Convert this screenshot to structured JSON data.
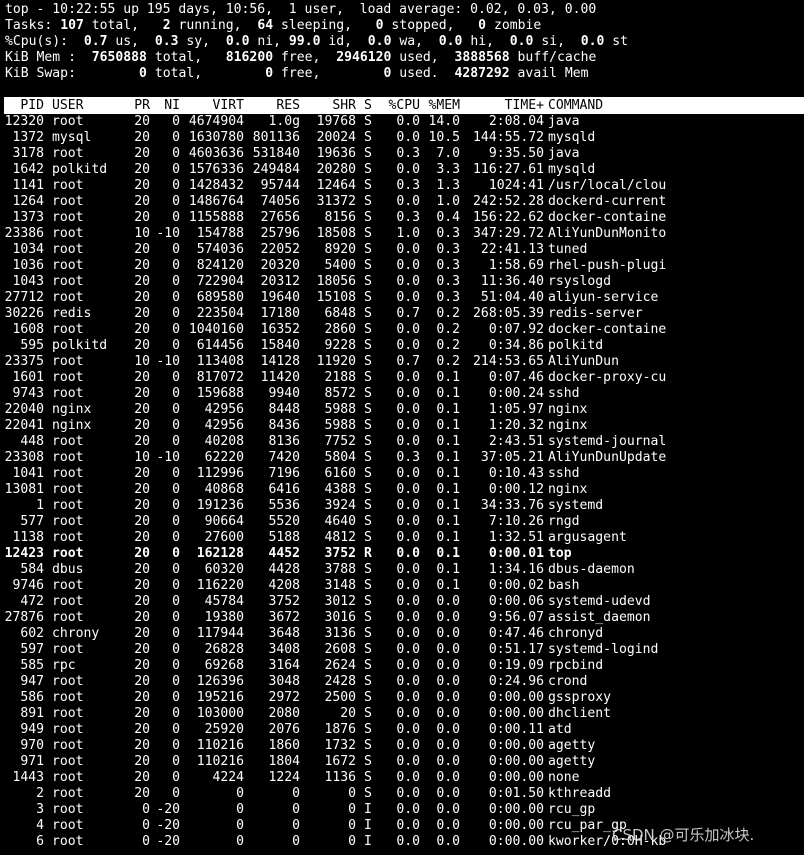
{
  "summary": {
    "line1": "top - 10:22:55 up 195 days, 10:56,  1 user,  load average: 0.02, 0.03, 0.00",
    "tasks": {
      "label": "Tasks:",
      "total": "107",
      "total_label": "total,",
      "running": "2",
      "running_label": "running,",
      "sleeping": "64",
      "sleeping_label": "sleeping,",
      "stopped": "0",
      "stopped_label": "stopped,",
      "zombie": "0",
      "zombie_label": "zombie"
    },
    "cpu": {
      "label": "%Cpu(s):",
      "us": "0.7",
      "us_label": "us,",
      "sy": "0.3",
      "sy_label": "sy,",
      "ni": "0.0",
      "ni_label": "ni,",
      "id": "99.0",
      "id_label": "id,",
      "wa": "0.0",
      "wa_label": "wa,",
      "hi": "0.0",
      "hi_label": "hi,",
      "si": "0.0",
      "si_label": "si,",
      "st": "0.0",
      "st_label": "st"
    },
    "mem": {
      "label": "KiB Mem :",
      "total": "7650888",
      "total_label": "total,",
      "free": "816200",
      "free_label": "free,",
      "used": "2946120",
      "used_label": "used,",
      "buff": "3888568",
      "buff_label": "buff/cache"
    },
    "swap": {
      "label": "KiB Swap:",
      "total": "0",
      "total_label": "total,",
      "free": "0",
      "free_label": "free,",
      "used": "0",
      "used_label": "used.",
      "avail": "4287292",
      "avail_label": "avail Mem"
    }
  },
  "columns": {
    "pid": "PID",
    "user": "USER",
    "pr": "PR",
    "ni": "NI",
    "virt": "VIRT",
    "res": "RES",
    "shr": "SHR",
    "s": "S",
    "cpu": "%CPU",
    "mem": "%MEM",
    "time": "TIME+",
    "cmd": "COMMAND"
  },
  "processes": [
    {
      "pid": "12320",
      "user": "root",
      "pr": "20",
      "ni": "0",
      "virt": "4674904",
      "res": "1.0g",
      "shr": "19768",
      "s": "S",
      "cpu": "0.0",
      "mem": "14.0",
      "time": "2:08.04",
      "cmd": "java"
    },
    {
      "pid": "1372",
      "user": "mysql",
      "pr": "20",
      "ni": "0",
      "virt": "1630780",
      "res": "801136",
      "shr": "20024",
      "s": "S",
      "cpu": "0.0",
      "mem": "10.5",
      "time": "144:55.72",
      "cmd": "mysqld"
    },
    {
      "pid": "3178",
      "user": "root",
      "pr": "20",
      "ni": "0",
      "virt": "4603636",
      "res": "531840",
      "shr": "19636",
      "s": "S",
      "cpu": "0.3",
      "mem": "7.0",
      "time": "9:35.50",
      "cmd": "java"
    },
    {
      "pid": "1642",
      "user": "polkitd",
      "pr": "20",
      "ni": "0",
      "virt": "1576336",
      "res": "249484",
      "shr": "20280",
      "s": "S",
      "cpu": "0.0",
      "mem": "3.3",
      "time": "116:27.61",
      "cmd": "mysqld"
    },
    {
      "pid": "1141",
      "user": "root",
      "pr": "20",
      "ni": "0",
      "virt": "1428432",
      "res": "95744",
      "shr": "12464",
      "s": "S",
      "cpu": "0.3",
      "mem": "1.3",
      "time": "1024:41",
      "cmd": "/usr/local/clou"
    },
    {
      "pid": "1264",
      "user": "root",
      "pr": "20",
      "ni": "0",
      "virt": "1486764",
      "res": "74056",
      "shr": "31372",
      "s": "S",
      "cpu": "0.0",
      "mem": "1.0",
      "time": "242:52.28",
      "cmd": "dockerd-current"
    },
    {
      "pid": "1373",
      "user": "root",
      "pr": "20",
      "ni": "0",
      "virt": "1155888",
      "res": "27656",
      "shr": "8156",
      "s": "S",
      "cpu": "0.3",
      "mem": "0.4",
      "time": "156:22.62",
      "cmd": "docker-containe"
    },
    {
      "pid": "23386",
      "user": "root",
      "pr": "10",
      "ni": "-10",
      "virt": "154788",
      "res": "25796",
      "shr": "18508",
      "s": "S",
      "cpu": "1.0",
      "mem": "0.3",
      "time": "347:29.72",
      "cmd": "AliYunDunMonito"
    },
    {
      "pid": "1034",
      "user": "root",
      "pr": "20",
      "ni": "0",
      "virt": "574036",
      "res": "22052",
      "shr": "8920",
      "s": "S",
      "cpu": "0.0",
      "mem": "0.3",
      "time": "22:41.13",
      "cmd": "tuned"
    },
    {
      "pid": "1036",
      "user": "root",
      "pr": "20",
      "ni": "0",
      "virt": "824120",
      "res": "20320",
      "shr": "5400",
      "s": "S",
      "cpu": "0.0",
      "mem": "0.3",
      "time": "1:58.69",
      "cmd": "rhel-push-plugi"
    },
    {
      "pid": "1043",
      "user": "root",
      "pr": "20",
      "ni": "0",
      "virt": "722904",
      "res": "20312",
      "shr": "18056",
      "s": "S",
      "cpu": "0.0",
      "mem": "0.3",
      "time": "11:36.40",
      "cmd": "rsyslogd"
    },
    {
      "pid": "27712",
      "user": "root",
      "pr": "20",
      "ni": "0",
      "virt": "689580",
      "res": "19640",
      "shr": "15108",
      "s": "S",
      "cpu": "0.0",
      "mem": "0.3",
      "time": "51:04.40",
      "cmd": "aliyun-service"
    },
    {
      "pid": "30226",
      "user": "redis",
      "pr": "20",
      "ni": "0",
      "virt": "223504",
      "res": "17180",
      "shr": "6848",
      "s": "S",
      "cpu": "0.7",
      "mem": "0.2",
      "time": "268:05.39",
      "cmd": "redis-server"
    },
    {
      "pid": "1608",
      "user": "root",
      "pr": "20",
      "ni": "0",
      "virt": "1040160",
      "res": "16352",
      "shr": "2860",
      "s": "S",
      "cpu": "0.0",
      "mem": "0.2",
      "time": "0:07.92",
      "cmd": "docker-containe"
    },
    {
      "pid": "595",
      "user": "polkitd",
      "pr": "20",
      "ni": "0",
      "virt": "614456",
      "res": "15840",
      "shr": "9228",
      "s": "S",
      "cpu": "0.0",
      "mem": "0.2",
      "time": "0:34.86",
      "cmd": "polkitd"
    },
    {
      "pid": "23375",
      "user": "root",
      "pr": "10",
      "ni": "-10",
      "virt": "113408",
      "res": "14128",
      "shr": "11920",
      "s": "S",
      "cpu": "0.7",
      "mem": "0.2",
      "time": "214:53.65",
      "cmd": "AliYunDun"
    },
    {
      "pid": "1601",
      "user": "root",
      "pr": "20",
      "ni": "0",
      "virt": "817072",
      "res": "11420",
      "shr": "2188",
      "s": "S",
      "cpu": "0.0",
      "mem": "0.1",
      "time": "0:07.46",
      "cmd": "docker-proxy-cu"
    },
    {
      "pid": "9743",
      "user": "root",
      "pr": "20",
      "ni": "0",
      "virt": "159688",
      "res": "9940",
      "shr": "8572",
      "s": "S",
      "cpu": "0.0",
      "mem": "0.1",
      "time": "0:00.24",
      "cmd": "sshd"
    },
    {
      "pid": "22040",
      "user": "nginx",
      "pr": "20",
      "ni": "0",
      "virt": "42956",
      "res": "8448",
      "shr": "5988",
      "s": "S",
      "cpu": "0.0",
      "mem": "0.1",
      "time": "1:05.97",
      "cmd": "nginx"
    },
    {
      "pid": "22041",
      "user": "nginx",
      "pr": "20",
      "ni": "0",
      "virt": "42956",
      "res": "8436",
      "shr": "5988",
      "s": "S",
      "cpu": "0.0",
      "mem": "0.1",
      "time": "1:20.32",
      "cmd": "nginx"
    },
    {
      "pid": "448",
      "user": "root",
      "pr": "20",
      "ni": "0",
      "virt": "40208",
      "res": "8136",
      "shr": "7752",
      "s": "S",
      "cpu": "0.0",
      "mem": "0.1",
      "time": "2:43.51",
      "cmd": "systemd-journal"
    },
    {
      "pid": "23308",
      "user": "root",
      "pr": "10",
      "ni": "-10",
      "virt": "62220",
      "res": "7420",
      "shr": "5804",
      "s": "S",
      "cpu": "0.3",
      "mem": "0.1",
      "time": "37:05.21",
      "cmd": "AliYunDunUpdate"
    },
    {
      "pid": "1041",
      "user": "root",
      "pr": "20",
      "ni": "0",
      "virt": "112996",
      "res": "7196",
      "shr": "6160",
      "s": "S",
      "cpu": "0.0",
      "mem": "0.1",
      "time": "0:10.43",
      "cmd": "sshd"
    },
    {
      "pid": "13081",
      "user": "root",
      "pr": "20",
      "ni": "0",
      "virt": "40868",
      "res": "6416",
      "shr": "4388",
      "s": "S",
      "cpu": "0.0",
      "mem": "0.1",
      "time": "0:00.12",
      "cmd": "nginx"
    },
    {
      "pid": "1",
      "user": "root",
      "pr": "20",
      "ni": "0",
      "virt": "191236",
      "res": "5536",
      "shr": "3924",
      "s": "S",
      "cpu": "0.0",
      "mem": "0.1",
      "time": "34:33.76",
      "cmd": "systemd"
    },
    {
      "pid": "577",
      "user": "root",
      "pr": "20",
      "ni": "0",
      "virt": "90664",
      "res": "5520",
      "shr": "4640",
      "s": "S",
      "cpu": "0.0",
      "mem": "0.1",
      "time": "7:10.26",
      "cmd": "rngd"
    },
    {
      "pid": "1138",
      "user": "root",
      "pr": "20",
      "ni": "0",
      "virt": "27600",
      "res": "5188",
      "shr": "4812",
      "s": "S",
      "cpu": "0.0",
      "mem": "0.1",
      "time": "1:32.51",
      "cmd": "argusagent"
    },
    {
      "pid": "12423",
      "user": "root",
      "pr": "20",
      "ni": "0",
      "virt": "162128",
      "res": "4452",
      "shr": "3752",
      "s": "R",
      "cpu": "0.0",
      "mem": "0.1",
      "time": "0:00.01",
      "cmd": "top",
      "bold": true
    },
    {
      "pid": "584",
      "user": "dbus",
      "pr": "20",
      "ni": "0",
      "virt": "60320",
      "res": "4428",
      "shr": "3788",
      "s": "S",
      "cpu": "0.0",
      "mem": "0.1",
      "time": "1:34.16",
      "cmd": "dbus-daemon"
    },
    {
      "pid": "9746",
      "user": "root",
      "pr": "20",
      "ni": "0",
      "virt": "116220",
      "res": "4208",
      "shr": "3148",
      "s": "S",
      "cpu": "0.0",
      "mem": "0.1",
      "time": "0:00.02",
      "cmd": "bash"
    },
    {
      "pid": "472",
      "user": "root",
      "pr": "20",
      "ni": "0",
      "virt": "45784",
      "res": "3752",
      "shr": "3012",
      "s": "S",
      "cpu": "0.0",
      "mem": "0.0",
      "time": "0:00.06",
      "cmd": "systemd-udevd"
    },
    {
      "pid": "27876",
      "user": "root",
      "pr": "20",
      "ni": "0",
      "virt": "19380",
      "res": "3672",
      "shr": "3016",
      "s": "S",
      "cpu": "0.0",
      "mem": "0.0",
      "time": "9:56.07",
      "cmd": "assist_daemon"
    },
    {
      "pid": "602",
      "user": "chrony",
      "pr": "20",
      "ni": "0",
      "virt": "117944",
      "res": "3648",
      "shr": "3136",
      "s": "S",
      "cpu": "0.0",
      "mem": "0.0",
      "time": "0:47.46",
      "cmd": "chronyd"
    },
    {
      "pid": "597",
      "user": "root",
      "pr": "20",
      "ni": "0",
      "virt": "26828",
      "res": "3408",
      "shr": "2608",
      "s": "S",
      "cpu": "0.0",
      "mem": "0.0",
      "time": "0:51.17",
      "cmd": "systemd-logind"
    },
    {
      "pid": "585",
      "user": "rpc",
      "pr": "20",
      "ni": "0",
      "virt": "69268",
      "res": "3164",
      "shr": "2624",
      "s": "S",
      "cpu": "0.0",
      "mem": "0.0",
      "time": "0:19.09",
      "cmd": "rpcbind"
    },
    {
      "pid": "947",
      "user": "root",
      "pr": "20",
      "ni": "0",
      "virt": "126396",
      "res": "3048",
      "shr": "2428",
      "s": "S",
      "cpu": "0.0",
      "mem": "0.0",
      "time": "0:24.96",
      "cmd": "crond"
    },
    {
      "pid": "586",
      "user": "root",
      "pr": "20",
      "ni": "0",
      "virt": "195216",
      "res": "2972",
      "shr": "2500",
      "s": "S",
      "cpu": "0.0",
      "mem": "0.0",
      "time": "0:00.00",
      "cmd": "gssproxy"
    },
    {
      "pid": "891",
      "user": "root",
      "pr": "20",
      "ni": "0",
      "virt": "103000",
      "res": "2080",
      "shr": "20",
      "s": "S",
      "cpu": "0.0",
      "mem": "0.0",
      "time": "0:00.00",
      "cmd": "dhclient"
    },
    {
      "pid": "949",
      "user": "root",
      "pr": "20",
      "ni": "0",
      "virt": "25920",
      "res": "2076",
      "shr": "1876",
      "s": "S",
      "cpu": "0.0",
      "mem": "0.0",
      "time": "0:00.11",
      "cmd": "atd"
    },
    {
      "pid": "970",
      "user": "root",
      "pr": "20",
      "ni": "0",
      "virt": "110216",
      "res": "1860",
      "shr": "1732",
      "s": "S",
      "cpu": "0.0",
      "mem": "0.0",
      "time": "0:00.00",
      "cmd": "agetty"
    },
    {
      "pid": "971",
      "user": "root",
      "pr": "20",
      "ni": "0",
      "virt": "110216",
      "res": "1804",
      "shr": "1672",
      "s": "S",
      "cpu": "0.0",
      "mem": "0.0",
      "time": "0:00.00",
      "cmd": "agetty"
    },
    {
      "pid": "1443",
      "user": "root",
      "pr": "20",
      "ni": "0",
      "virt": "4224",
      "res": "1224",
      "shr": "1136",
      "s": "S",
      "cpu": "0.0",
      "mem": "0.0",
      "time": "0:00.00",
      "cmd": "none"
    },
    {
      "pid": "2",
      "user": "root",
      "pr": "20",
      "ni": "0",
      "virt": "0",
      "res": "0",
      "shr": "0",
      "s": "S",
      "cpu": "0.0",
      "mem": "0.0",
      "time": "0:01.50",
      "cmd": "kthreadd"
    },
    {
      "pid": "3",
      "user": "root",
      "pr": "0",
      "ni": "-20",
      "virt": "0",
      "res": "0",
      "shr": "0",
      "s": "I",
      "cpu": "0.0",
      "mem": "0.0",
      "time": "0:00.00",
      "cmd": "rcu_gp"
    },
    {
      "pid": "4",
      "user": "root",
      "pr": "0",
      "ni": "-20",
      "virt": "0",
      "res": "0",
      "shr": "0",
      "s": "I",
      "cpu": "0.0",
      "mem": "0.0",
      "time": "0:00.00",
      "cmd": "rcu_par_gp"
    },
    {
      "pid": "6",
      "user": "root",
      "pr": "0",
      "ni": "-20",
      "virt": "0",
      "res": "0",
      "shr": "0",
      "s": "I",
      "cpu": "0.0",
      "mem": "0.0",
      "time": "0:00.00",
      "cmd": "kworker/0:0H-kb"
    }
  ],
  "watermark": "CSDN @可乐加冰块.",
  "colors": {
    "background": "#000000",
    "foreground": "#ffffff",
    "header_bg": "#ffffff",
    "header_fg": "#000000"
  }
}
